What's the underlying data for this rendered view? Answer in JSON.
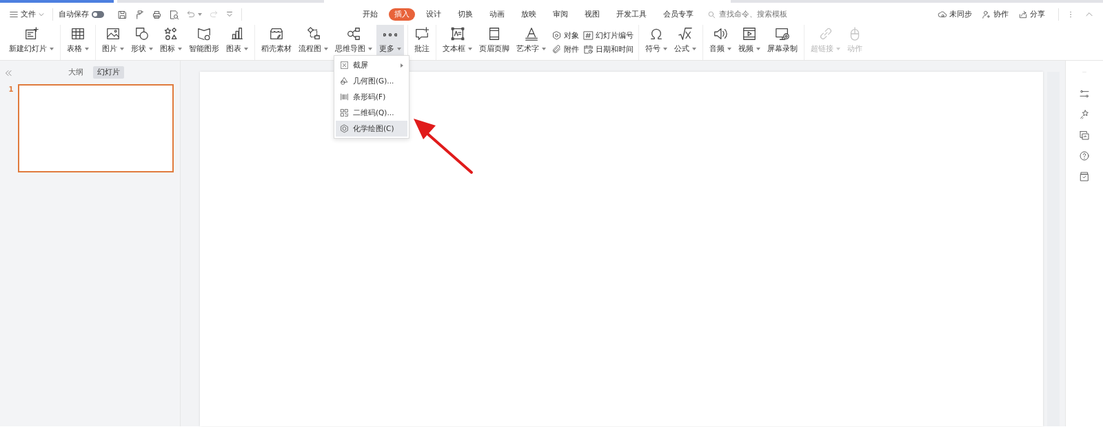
{
  "quick_access": {
    "menu_label": "文件",
    "autosave_label": "自动保存",
    "autosave_on": false
  },
  "tabs": [
    {
      "label": "开始",
      "selected": false
    },
    {
      "label": "插入",
      "selected": true
    },
    {
      "label": "设计",
      "selected": false
    },
    {
      "label": "切换",
      "selected": false
    },
    {
      "label": "动画",
      "selected": false
    },
    {
      "label": "放映",
      "selected": false
    },
    {
      "label": "审阅",
      "selected": false
    },
    {
      "label": "视图",
      "selected": false
    },
    {
      "label": "开发工具",
      "selected": false
    },
    {
      "label": "会员专享",
      "selected": false
    }
  ],
  "search": {
    "placeholder": "查找命令、搜索模板"
  },
  "account_actions": [
    {
      "label": "未同步"
    },
    {
      "label": "协作"
    },
    {
      "label": "分享"
    }
  ],
  "ribbon": {
    "groups": [
      {
        "items": [
          {
            "kind": "large",
            "label": "新建幻灯片",
            "dropdown": true,
            "pressed": false,
            "disabled": false
          }
        ]
      },
      {
        "items": [
          {
            "kind": "large",
            "label": "表格",
            "dropdown": true,
            "pressed": false,
            "disabled": false
          }
        ]
      },
      {
        "items": [
          {
            "kind": "large",
            "label": "图片",
            "dropdown": true,
            "pressed": false,
            "disabled": false
          },
          {
            "kind": "large",
            "label": "形状",
            "dropdown": true,
            "pressed": false,
            "disabled": false
          },
          {
            "kind": "large",
            "label": "图标",
            "dropdown": true,
            "pressed": false,
            "disabled": false
          },
          {
            "kind": "large",
            "label": "智能图形",
            "dropdown": false,
            "pressed": false,
            "disabled": false
          },
          {
            "kind": "large",
            "label": "图表",
            "dropdown": true,
            "pressed": false,
            "disabled": false
          }
        ]
      },
      {
        "items": [
          {
            "kind": "large",
            "label": "稻壳素材",
            "dropdown": false,
            "pressed": false,
            "disabled": false
          },
          {
            "kind": "large",
            "label": "流程图",
            "dropdown": true,
            "pressed": false,
            "disabled": false
          },
          {
            "kind": "large",
            "label": "思维导图",
            "dropdown": true,
            "pressed": false,
            "disabled": false
          },
          {
            "kind": "large",
            "label": "更多",
            "dropdown": true,
            "pressed": true,
            "disabled": false
          }
        ]
      },
      {
        "items": [
          {
            "kind": "large",
            "label": "批注",
            "dropdown": false,
            "pressed": false,
            "disabled": false
          }
        ]
      },
      {
        "items": [
          {
            "kind": "large",
            "label": "文本框",
            "dropdown": true,
            "pressed": false,
            "disabled": false
          },
          {
            "kind": "large",
            "label": "页眉页脚",
            "dropdown": false,
            "pressed": false,
            "disabled": false
          },
          {
            "kind": "large",
            "label": "艺术字",
            "dropdown": true,
            "pressed": false,
            "disabled": false
          },
          {
            "kind": "stack",
            "items": [
              {
                "label": "对象"
              },
              {
                "label": "附件"
              }
            ]
          },
          {
            "kind": "stack",
            "items": [
              {
                "label": "幻灯片编号"
              },
              {
                "label": "日期和时间"
              }
            ]
          }
        ]
      },
      {
        "items": [
          {
            "kind": "large",
            "label": "符号",
            "dropdown": true,
            "pressed": false,
            "disabled": false
          },
          {
            "kind": "large",
            "label": "公式",
            "dropdown": true,
            "pressed": false,
            "disabled": false
          }
        ]
      },
      {
        "items": [
          {
            "kind": "large",
            "label": "音频",
            "dropdown": true,
            "pressed": false,
            "disabled": false
          },
          {
            "kind": "large",
            "label": "视频",
            "dropdown": true,
            "pressed": false,
            "disabled": false
          },
          {
            "kind": "large",
            "label": "屏幕录制",
            "dropdown": false,
            "pressed": false,
            "disabled": false
          }
        ]
      },
      {
        "items": [
          {
            "kind": "large",
            "label": "超链接",
            "dropdown": true,
            "pressed": false,
            "disabled": true
          },
          {
            "kind": "large",
            "label": "动作",
            "dropdown": false,
            "pressed": false,
            "disabled": true
          }
        ]
      }
    ]
  },
  "left_panel": {
    "view_tabs": [
      {
        "label": "大纲",
        "selected": false
      },
      {
        "label": "幻灯片",
        "selected": true
      }
    ],
    "slides": [
      {
        "number": "1",
        "selected": true
      }
    ]
  },
  "more_menu": {
    "items": [
      {
        "label": "截屏",
        "submenu": true,
        "highlighted": false
      },
      {
        "label": "几何图(G)...",
        "submenu": false,
        "highlighted": false
      },
      {
        "label": "条形码(F)",
        "submenu": false,
        "highlighted": false
      },
      {
        "label": "二维码(Q)...",
        "submenu": false,
        "highlighted": false
      },
      {
        "label": "化学绘图(C)",
        "submenu": false,
        "highlighted": true
      }
    ]
  }
}
